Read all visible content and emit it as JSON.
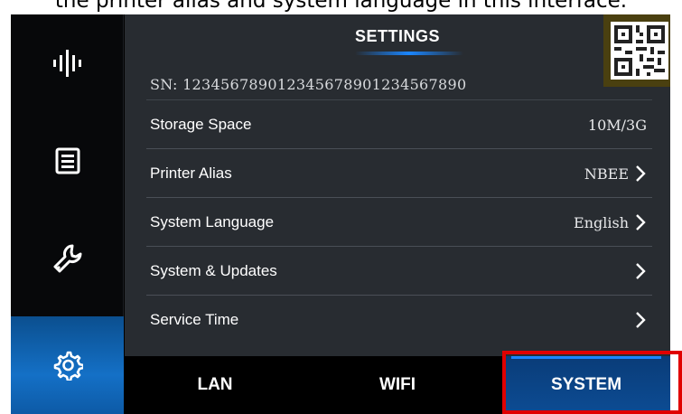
{
  "caption": "the printer alias and system language in this interface.",
  "sidebar": {
    "items": [
      {
        "icon": "audio-wave-icon",
        "active": false
      },
      {
        "icon": "document-list-icon",
        "active": false
      },
      {
        "icon": "wrench-icon",
        "active": false
      },
      {
        "icon": "settings-gear-icon",
        "active": true
      }
    ]
  },
  "panel": {
    "title": "SETTINGS",
    "serial": "SN: 123456789012345678901234567890",
    "rows": [
      {
        "label": "Storage Space",
        "value": "10M/3G",
        "chevron": false
      },
      {
        "label": "Printer Alias",
        "value": "NBEE",
        "chevron": true
      },
      {
        "label": "System Language",
        "value": "English",
        "chevron": true
      },
      {
        "label": "System & Updates",
        "value": "",
        "chevron": true
      },
      {
        "label": "Service Time",
        "value": "",
        "chevron": true
      }
    ]
  },
  "tabs": [
    {
      "label": "LAN",
      "active": false
    },
    {
      "label": "WIFI",
      "active": false
    },
    {
      "label": "SYSTEM",
      "active": true
    }
  ],
  "colors": {
    "accent": "#1a86ff",
    "panel_bg": "#282c31",
    "highlight": "#e00000"
  }
}
